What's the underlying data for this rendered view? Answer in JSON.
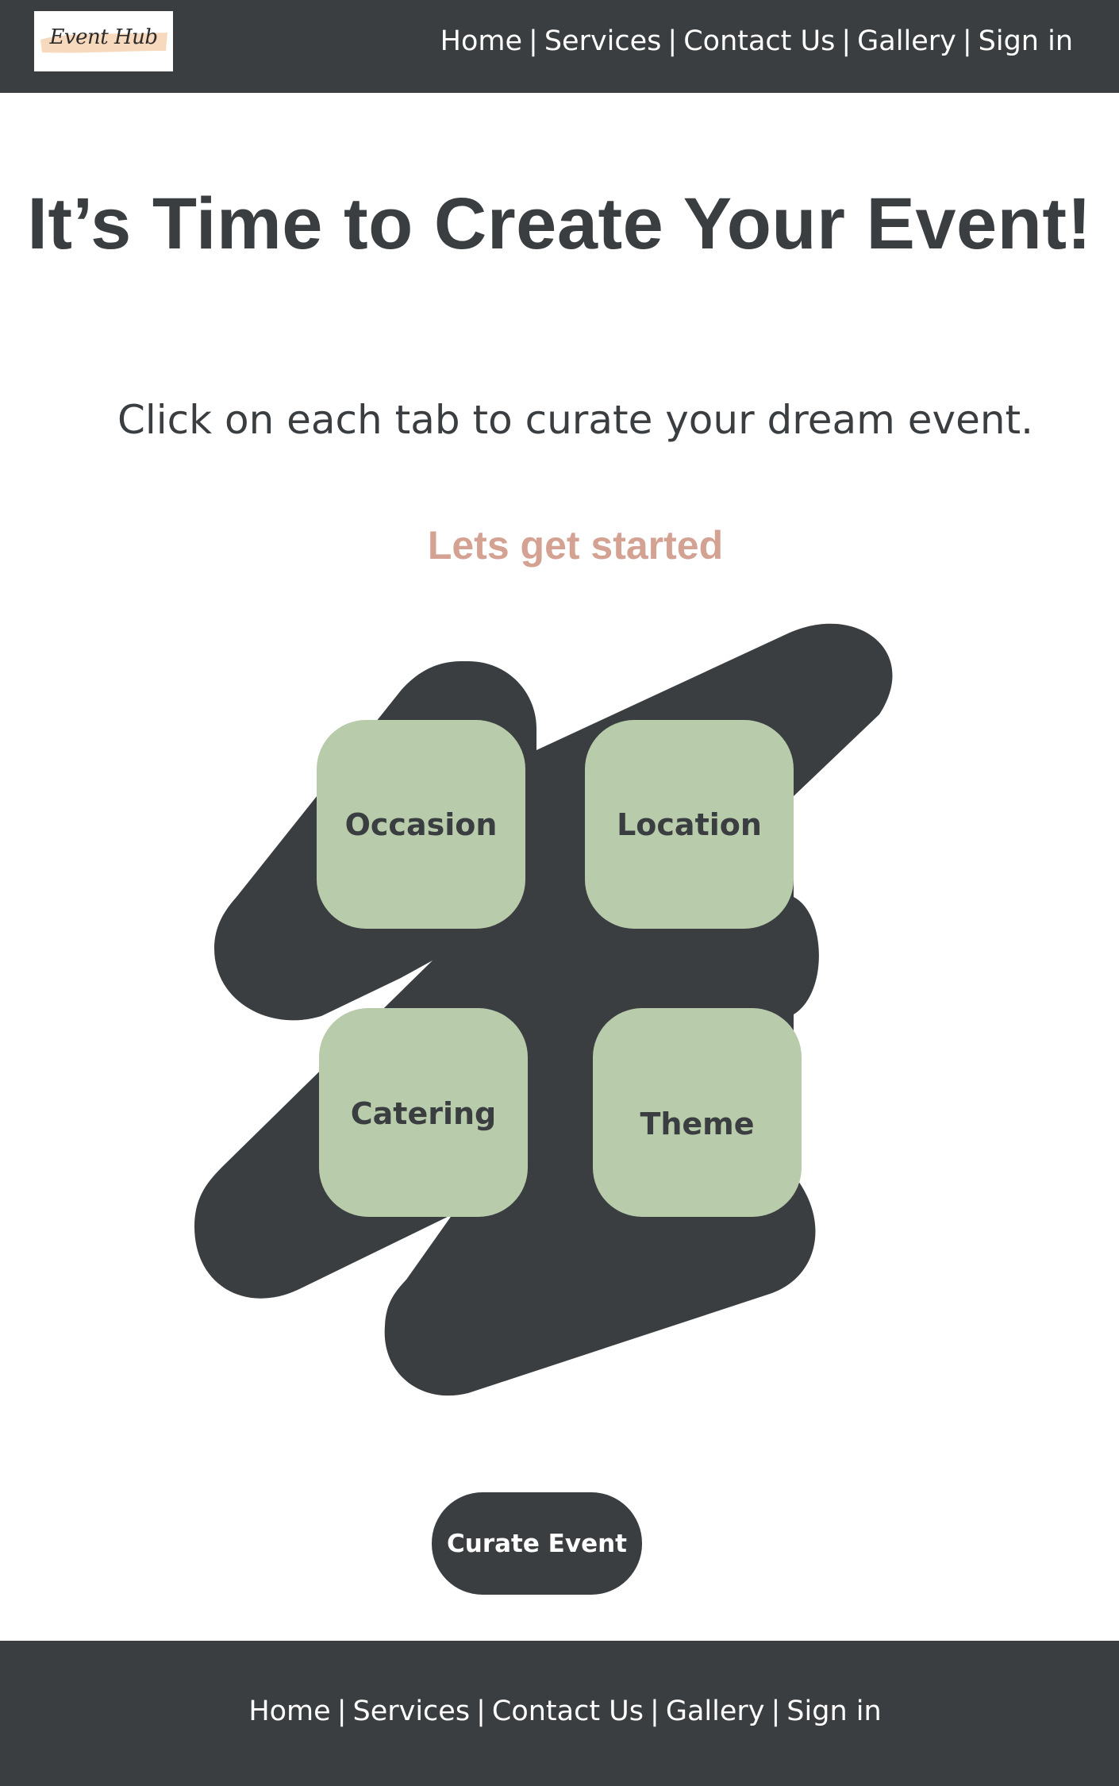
{
  "header": {
    "logo_text": "Event Hub",
    "nav": [
      "Home",
      "Services",
      "Contact Us",
      "Gallery",
      "Sign in"
    ],
    "separator": "|"
  },
  "main": {
    "title": "It’s Time to Create Your Event!",
    "subtitle": "Click on each tab to curate your dream event.",
    "started_label": "Lets get started",
    "tiles": [
      "Occasion",
      "Location",
      "Catering",
      "Theme"
    ],
    "cta_label": "Curate Event"
  },
  "footer": {
    "nav": [
      "Home",
      "Services",
      "Contact Us",
      "Gallery",
      "Sign in"
    ],
    "separator": "|"
  },
  "colors": {
    "dark": "#3a3e41",
    "tile": "#b8cbaa",
    "accent": "#d4a293",
    "logo_brush": "#f7d9bd"
  }
}
